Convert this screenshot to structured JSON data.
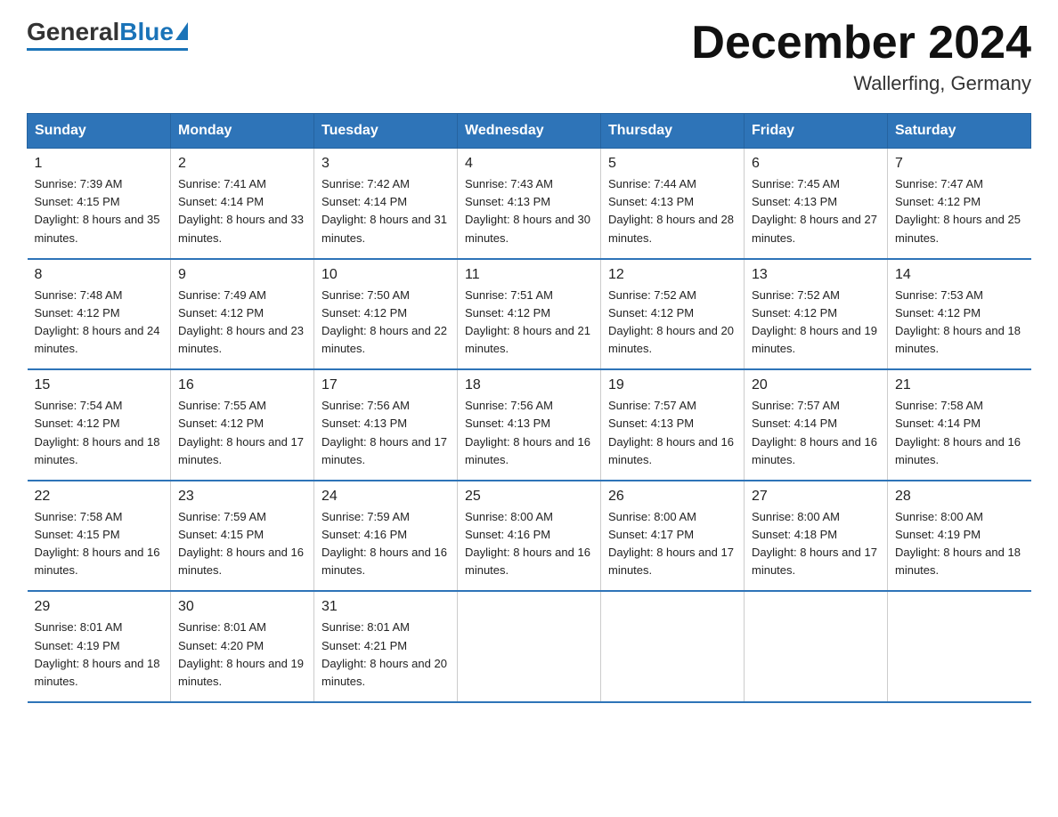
{
  "header": {
    "logo_general": "General",
    "logo_blue": "Blue",
    "month_title": "December 2024",
    "location": "Wallerfing, Germany"
  },
  "days_of_week": [
    "Sunday",
    "Monday",
    "Tuesday",
    "Wednesday",
    "Thursday",
    "Friday",
    "Saturday"
  ],
  "weeks": [
    [
      {
        "day": "1",
        "sunrise": "7:39 AM",
        "sunset": "4:15 PM",
        "daylight": "8 hours and 35 minutes."
      },
      {
        "day": "2",
        "sunrise": "7:41 AM",
        "sunset": "4:14 PM",
        "daylight": "8 hours and 33 minutes."
      },
      {
        "day": "3",
        "sunrise": "7:42 AM",
        "sunset": "4:14 PM",
        "daylight": "8 hours and 31 minutes."
      },
      {
        "day": "4",
        "sunrise": "7:43 AM",
        "sunset": "4:13 PM",
        "daylight": "8 hours and 30 minutes."
      },
      {
        "day": "5",
        "sunrise": "7:44 AM",
        "sunset": "4:13 PM",
        "daylight": "8 hours and 28 minutes."
      },
      {
        "day": "6",
        "sunrise": "7:45 AM",
        "sunset": "4:13 PM",
        "daylight": "8 hours and 27 minutes."
      },
      {
        "day": "7",
        "sunrise": "7:47 AM",
        "sunset": "4:12 PM",
        "daylight": "8 hours and 25 minutes."
      }
    ],
    [
      {
        "day": "8",
        "sunrise": "7:48 AM",
        "sunset": "4:12 PM",
        "daylight": "8 hours and 24 minutes."
      },
      {
        "day": "9",
        "sunrise": "7:49 AM",
        "sunset": "4:12 PM",
        "daylight": "8 hours and 23 minutes."
      },
      {
        "day": "10",
        "sunrise": "7:50 AM",
        "sunset": "4:12 PM",
        "daylight": "8 hours and 22 minutes."
      },
      {
        "day": "11",
        "sunrise": "7:51 AM",
        "sunset": "4:12 PM",
        "daylight": "8 hours and 21 minutes."
      },
      {
        "day": "12",
        "sunrise": "7:52 AM",
        "sunset": "4:12 PM",
        "daylight": "8 hours and 20 minutes."
      },
      {
        "day": "13",
        "sunrise": "7:52 AM",
        "sunset": "4:12 PM",
        "daylight": "8 hours and 19 minutes."
      },
      {
        "day": "14",
        "sunrise": "7:53 AM",
        "sunset": "4:12 PM",
        "daylight": "8 hours and 18 minutes."
      }
    ],
    [
      {
        "day": "15",
        "sunrise": "7:54 AM",
        "sunset": "4:12 PM",
        "daylight": "8 hours and 18 minutes."
      },
      {
        "day": "16",
        "sunrise": "7:55 AM",
        "sunset": "4:12 PM",
        "daylight": "8 hours and 17 minutes."
      },
      {
        "day": "17",
        "sunrise": "7:56 AM",
        "sunset": "4:13 PM",
        "daylight": "8 hours and 17 minutes."
      },
      {
        "day": "18",
        "sunrise": "7:56 AM",
        "sunset": "4:13 PM",
        "daylight": "8 hours and 16 minutes."
      },
      {
        "day": "19",
        "sunrise": "7:57 AM",
        "sunset": "4:13 PM",
        "daylight": "8 hours and 16 minutes."
      },
      {
        "day": "20",
        "sunrise": "7:57 AM",
        "sunset": "4:14 PM",
        "daylight": "8 hours and 16 minutes."
      },
      {
        "day": "21",
        "sunrise": "7:58 AM",
        "sunset": "4:14 PM",
        "daylight": "8 hours and 16 minutes."
      }
    ],
    [
      {
        "day": "22",
        "sunrise": "7:58 AM",
        "sunset": "4:15 PM",
        "daylight": "8 hours and 16 minutes."
      },
      {
        "day": "23",
        "sunrise": "7:59 AM",
        "sunset": "4:15 PM",
        "daylight": "8 hours and 16 minutes."
      },
      {
        "day": "24",
        "sunrise": "7:59 AM",
        "sunset": "4:16 PM",
        "daylight": "8 hours and 16 minutes."
      },
      {
        "day": "25",
        "sunrise": "8:00 AM",
        "sunset": "4:16 PM",
        "daylight": "8 hours and 16 minutes."
      },
      {
        "day": "26",
        "sunrise": "8:00 AM",
        "sunset": "4:17 PM",
        "daylight": "8 hours and 17 minutes."
      },
      {
        "day": "27",
        "sunrise": "8:00 AM",
        "sunset": "4:18 PM",
        "daylight": "8 hours and 17 minutes."
      },
      {
        "day": "28",
        "sunrise": "8:00 AM",
        "sunset": "4:19 PM",
        "daylight": "8 hours and 18 minutes."
      }
    ],
    [
      {
        "day": "29",
        "sunrise": "8:01 AM",
        "sunset": "4:19 PM",
        "daylight": "8 hours and 18 minutes."
      },
      {
        "day": "30",
        "sunrise": "8:01 AM",
        "sunset": "4:20 PM",
        "daylight": "8 hours and 19 minutes."
      },
      {
        "day": "31",
        "sunrise": "8:01 AM",
        "sunset": "4:21 PM",
        "daylight": "8 hours and 20 minutes."
      },
      null,
      null,
      null,
      null
    ]
  ]
}
